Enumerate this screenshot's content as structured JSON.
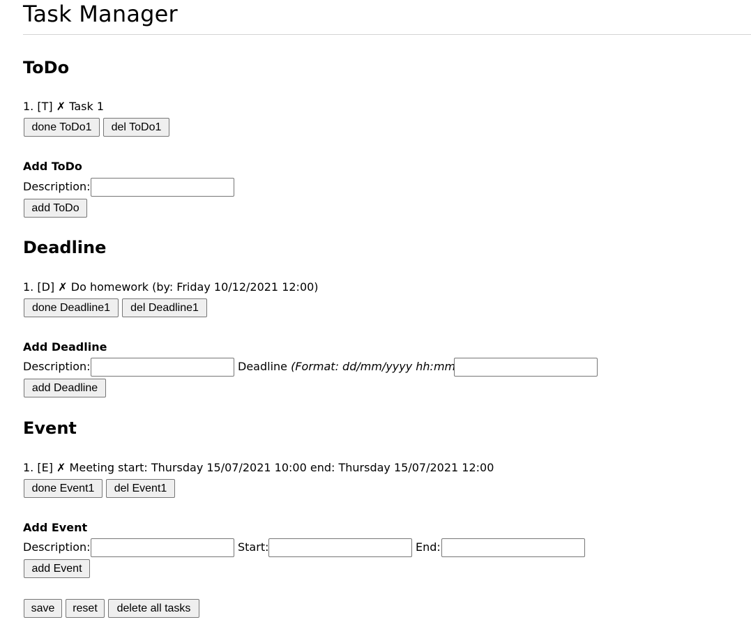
{
  "app": {
    "title": "Task Manager"
  },
  "todo": {
    "heading": "ToDo",
    "items": [
      {
        "number": "1.",
        "tag": "[T]",
        "status": "✗",
        "text": "Task 1",
        "done_label": "done ToDo1",
        "del_label": "del ToDo1"
      }
    ],
    "form": {
      "heading": "Add ToDo",
      "description_label": "Description:",
      "description_value": "",
      "submit_label": "add ToDo"
    }
  },
  "deadline": {
    "heading": "Deadline",
    "items": [
      {
        "number": "1.",
        "tag": "[D]",
        "status": "✗",
        "text": "Do homework (by: Friday 10/12/2021 12:00)",
        "done_label": "done Deadline1",
        "del_label": "del Deadline1"
      }
    ],
    "form": {
      "heading": "Add Deadline",
      "description_label": "Description:",
      "description_value": "",
      "deadline_label": "Deadline",
      "deadline_hint": "(Format: dd/mm/yyyy hh:mm):",
      "deadline_value": "",
      "submit_label": "add Deadline"
    }
  },
  "event": {
    "heading": "Event",
    "items": [
      {
        "number": "1.",
        "tag": "[E]",
        "status": "✗",
        "text": "Meeting start: Thursday 15/07/2021 10:00 end: Thursday 15/07/2021 12:00",
        "done_label": "done Event1",
        "del_label": "del Event1"
      }
    ],
    "form": {
      "heading": "Add Event",
      "description_label": "Description:",
      "description_value": "",
      "start_label": "Start:",
      "start_value": "",
      "end_label": "End:",
      "end_value": "",
      "submit_label": "add Event"
    }
  },
  "footer": {
    "save_label": "save",
    "reset_label": "reset",
    "delete_all_label": "delete all tasks"
  }
}
